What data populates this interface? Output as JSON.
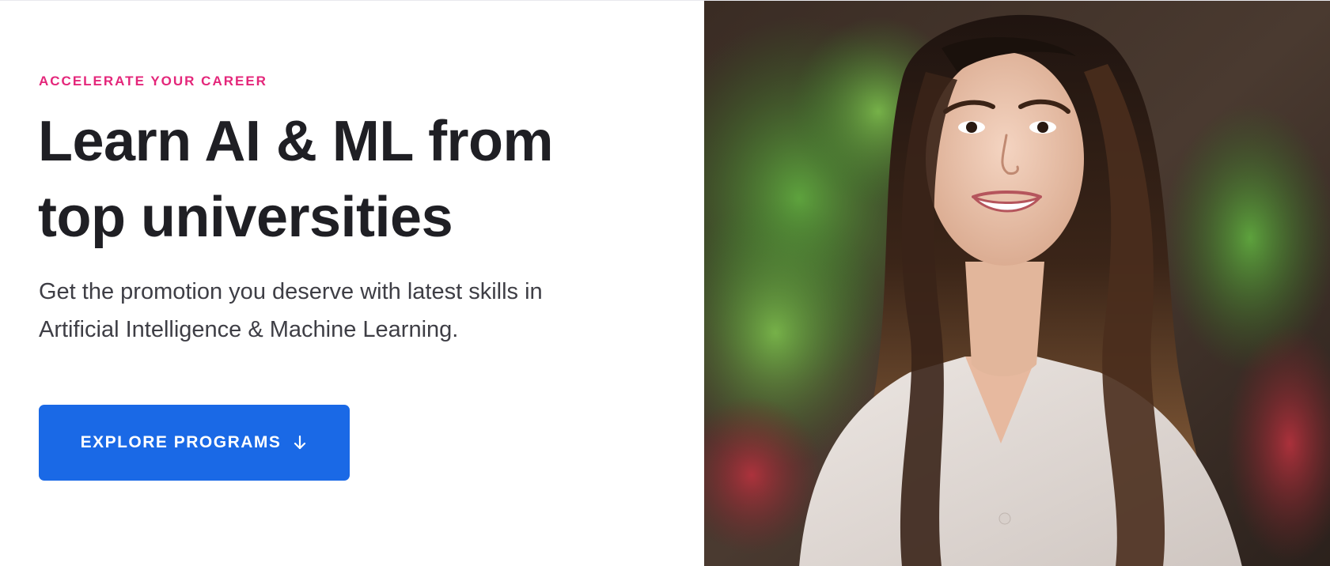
{
  "hero": {
    "eyebrow": "ACCELERATE YOUR CAREER",
    "headline_lines": [
      "Learn AI & ML from",
      "top universities"
    ],
    "subtext_lines": [
      "Get the promotion you deserve with latest skills in",
      "Artificial Intelligence & Machine Learning."
    ],
    "cta_label": "EXPLORE PROGRAMS",
    "cta_icon": "arrow-down-icon"
  },
  "colors": {
    "eyebrow": "#e4267a",
    "headline": "#1f1f24",
    "subtext": "#3e3e45",
    "cta_background": "#1a69e6",
    "cta_text": "#ffffff"
  }
}
